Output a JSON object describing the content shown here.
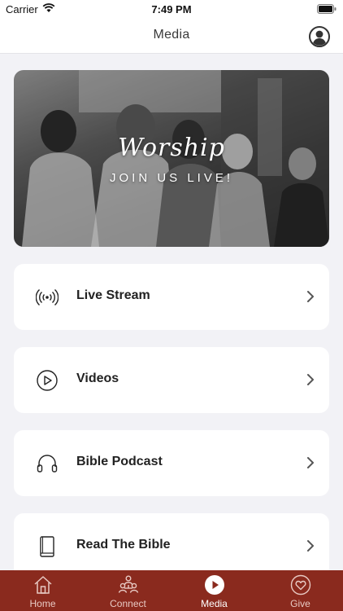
{
  "status_bar": {
    "carrier": "Carrier",
    "time": "7:49 PM"
  },
  "nav": {
    "title": "Media"
  },
  "hero": {
    "title": "Worship",
    "subtitle": "JOIN US LIVE!"
  },
  "menu": {
    "items": [
      {
        "label": "Live Stream",
        "icon": "broadcast-icon"
      },
      {
        "label": "Videos",
        "icon": "play-circle-icon"
      },
      {
        "label": "Bible Podcast",
        "icon": "headphones-icon"
      },
      {
        "label": "Read The Bible",
        "icon": "book-icon"
      }
    ]
  },
  "tab_bar": {
    "tabs": [
      {
        "label": "Home",
        "icon": "home-icon"
      },
      {
        "label": "Connect",
        "icon": "people-icon"
      },
      {
        "label": "Media",
        "icon": "play-icon"
      },
      {
        "label": "Give",
        "icon": "heart-icon"
      }
    ],
    "active": "Media"
  },
  "colors": {
    "tab_bar_background": "#8a2a1e",
    "page_background": "#f2f2f6",
    "card_background": "#ffffff"
  }
}
